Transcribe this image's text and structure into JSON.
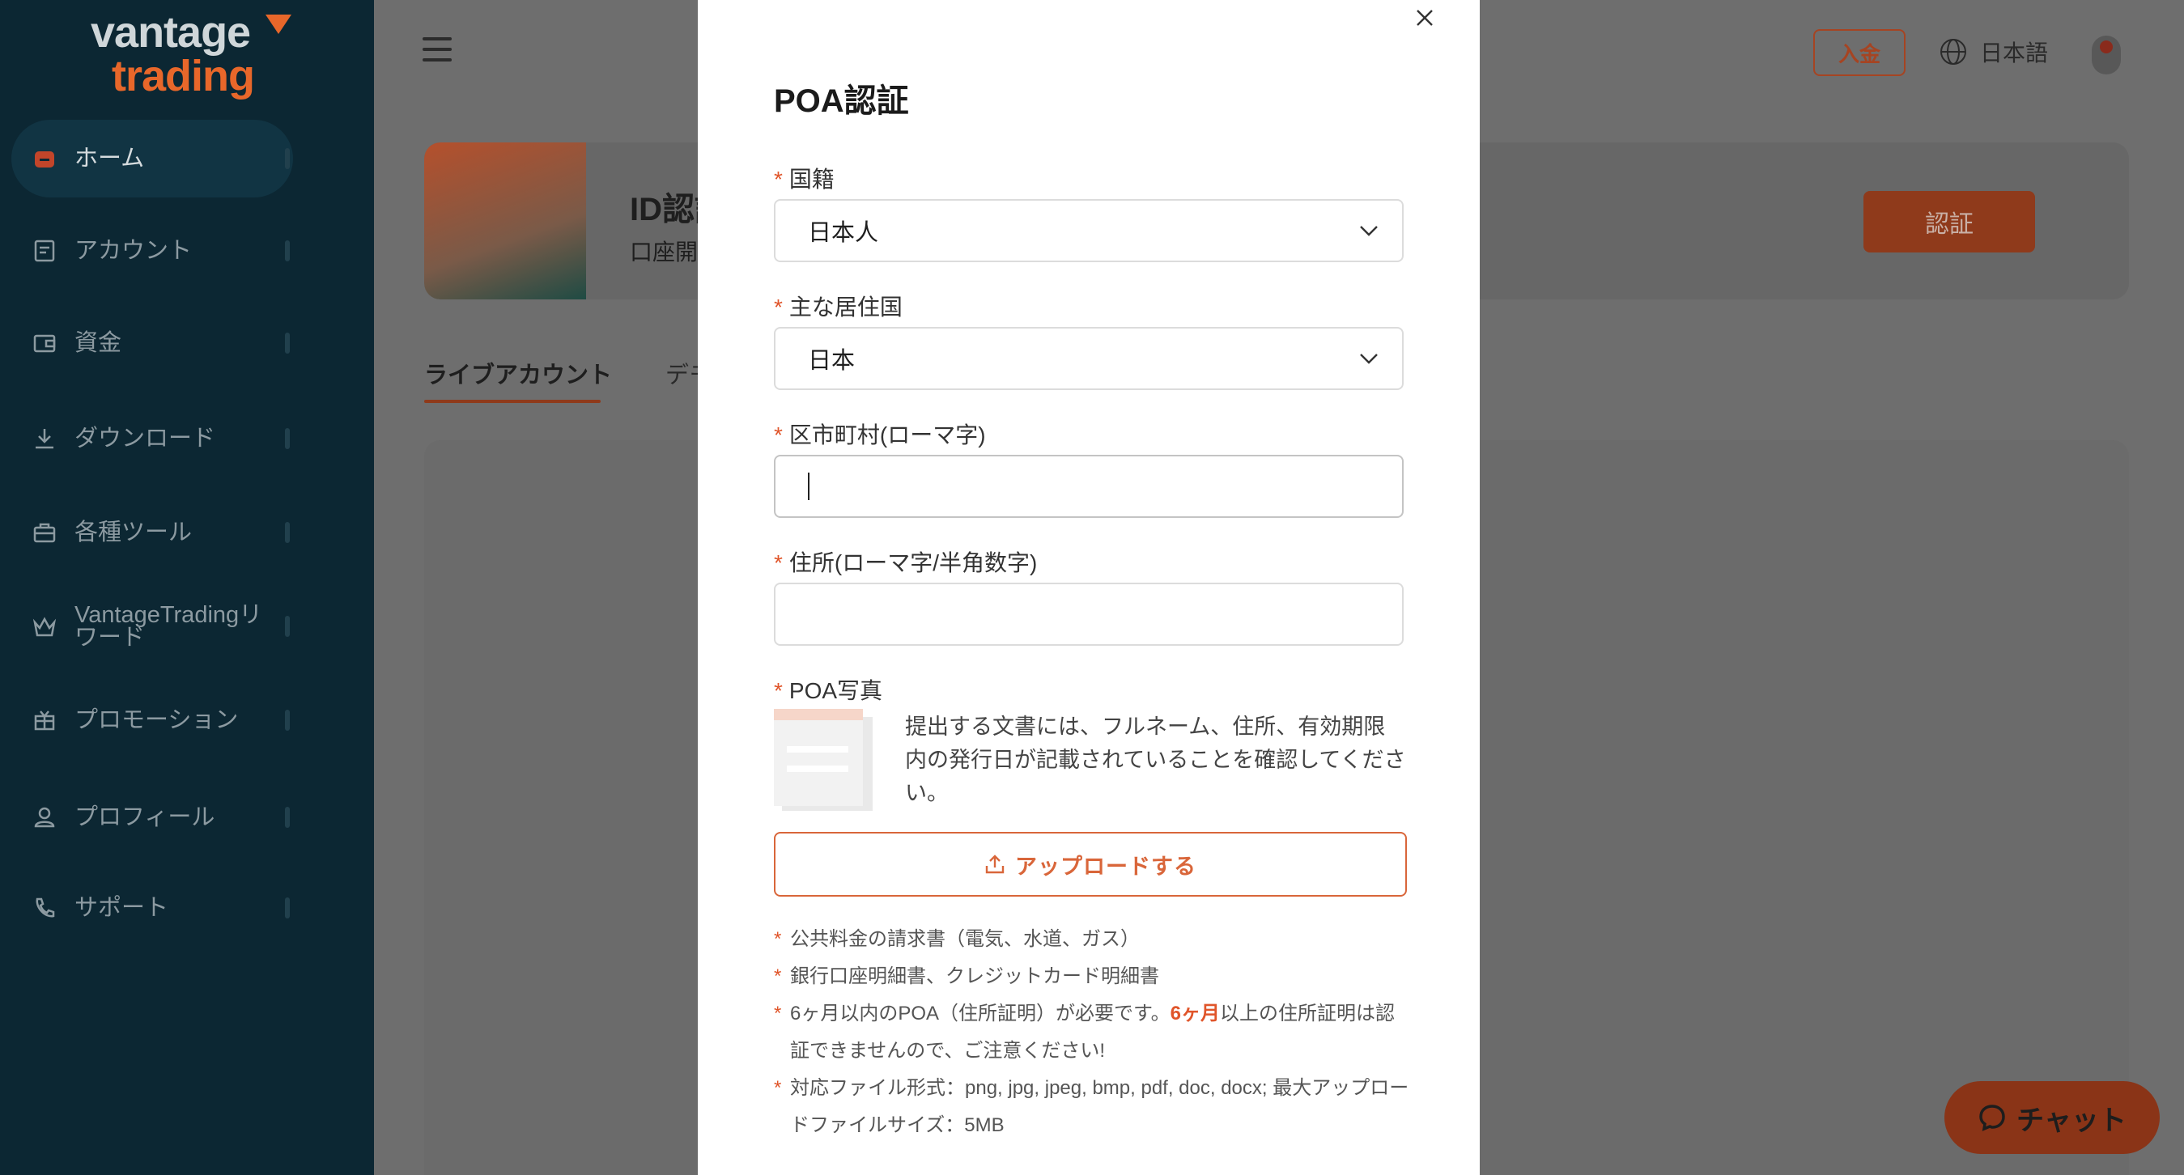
{
  "sidebar": {
    "logo_line1": "vantage",
    "logo_line2": "trading",
    "items": [
      {
        "label": "ホーム"
      },
      {
        "label": "アカウント"
      },
      {
        "label": "資金"
      },
      {
        "label": "ダウンロード"
      },
      {
        "label": "各種ツール"
      },
      {
        "label": "VantageTradingリワード"
      },
      {
        "label": "プロモーション"
      },
      {
        "label": "プロフィール"
      },
      {
        "label": "サポート"
      }
    ]
  },
  "header": {
    "deposit_label": "入金",
    "language_label": "日本語"
  },
  "banner": {
    "title": "ID認証",
    "subtitle": "口座開",
    "verify_label": "認証"
  },
  "tabs": {
    "live": "ライブアカウント",
    "demo": "デモ"
  },
  "chat": {
    "label": "チャット"
  },
  "modal": {
    "title": "POA認証",
    "nationality": {
      "label": "国籍",
      "value": "日本人"
    },
    "residence": {
      "label": "主な居住国",
      "value": "日本"
    },
    "city": {
      "label": "区市町村(ローマ字)",
      "value": ""
    },
    "address": {
      "label": "住所(ローマ字/半角数字)",
      "value": ""
    },
    "photo": {
      "label": "POA写真",
      "description": "提出する文書には、フルネーム、住所、有効期限内の発行日が記載されていることを確認してください。"
    },
    "upload_label": "アップロードする",
    "notes": {
      "n1": "公共料金の請求書（電気、水道、ガス）",
      "n2": "銀行口座明細書、クレジットカード明細書",
      "n3_before": "6ヶ月以内のPOA（住所証明）が必要です。",
      "n3_highlight": "6ヶ月",
      "n3_after": "以上の住所証明は認証できませんので、ご注意ください!",
      "n4": "対応ファイル形式：png, jpg, jpeg, bmp, pdf, doc, docx; 最大アップロードファイルサイズ：5MB"
    }
  },
  "colors": {
    "accent": "#e0552a",
    "sidebar_bg": "#0c2733",
    "overlay_bg": "#6e6e6e"
  }
}
